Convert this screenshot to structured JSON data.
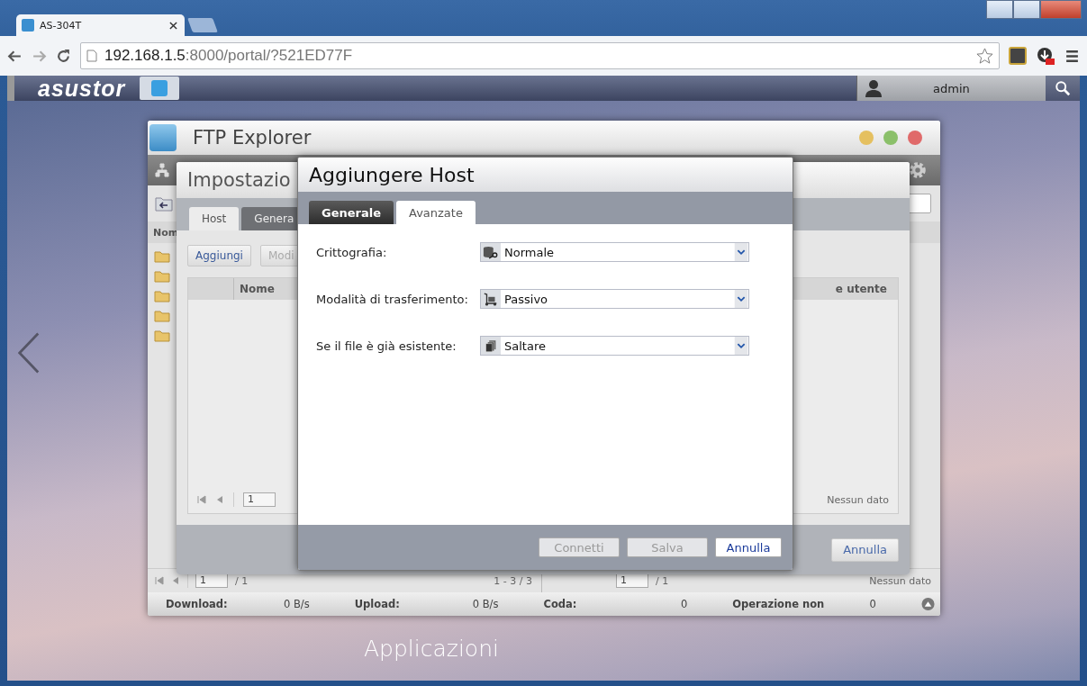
{
  "browser": {
    "tabs": [
      {
        "title": "AS-304T",
        "selected": true
      }
    ],
    "url_host": "192.168.1.5",
    "url_rest": ":8000/portal/?521ED77F"
  },
  "top_bar": {
    "brand": "asustor",
    "user": "admin"
  },
  "ftp_explorer": {
    "title": "FTP Explorer",
    "column_1": "Nom",
    "pager_left": {
      "page": "1",
      "total": "/ 1",
      "range": "1 - 3 / 3"
    },
    "pager_right": {
      "page": "1",
      "total": "/ 1",
      "status": "Nessun dato"
    },
    "status_bar": [
      {
        "label": "Download:",
        "value": "0 B/s"
      },
      {
        "label": "Upload:",
        "value": "0 B/s"
      },
      {
        "label": "Coda:",
        "value": "0"
      },
      {
        "label": "Operazione non",
        "value": "0"
      }
    ]
  },
  "settings": {
    "title": "Impostazio",
    "tabs": [
      {
        "label": "Host",
        "selected": true
      },
      {
        "label": "Genera",
        "selected": false
      }
    ],
    "buttons": [
      {
        "label": "Aggiungi",
        "disabled": false
      },
      {
        "label": "Modi",
        "disabled": true
      }
    ],
    "columns": [
      "Nome",
      "e utente"
    ],
    "pager": {
      "page": "1",
      "status": "Nessun dato"
    },
    "cancel": "Annulla"
  },
  "dialog": {
    "title": "Aggiungere Host",
    "tabs": [
      {
        "label": "Generale",
        "selected": false
      },
      {
        "label": "Avanzate",
        "selected": true
      }
    ],
    "fields": [
      {
        "label": "Crittografia:",
        "value": "Normale",
        "kind": "encryption"
      },
      {
        "label": "Modalità di trasferimento:",
        "value": "Passivo",
        "kind": "transfer"
      },
      {
        "label": "Se il file è già esistente:",
        "value": "Saltare",
        "kind": "existing"
      }
    ],
    "buttons": [
      {
        "label": "Connetti",
        "disabled": true
      },
      {
        "label": "Salva",
        "disabled": true
      },
      {
        "label": "Annulla",
        "disabled": false
      }
    ]
  },
  "desktop": {
    "label": "Applicazioni"
  }
}
